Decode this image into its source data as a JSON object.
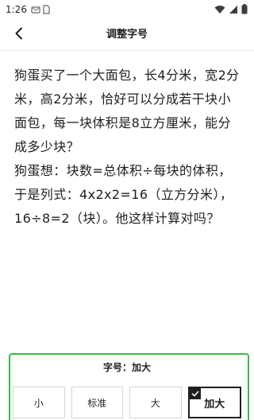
{
  "status_bar": {
    "time": "1:26",
    "icons": [
      "notification-icon",
      "sim-card-icon",
      "wifi-icon",
      "signal-icon",
      "battery-icon"
    ]
  },
  "app_bar": {
    "title": "调整字号",
    "back_icon": "chevron-left-icon"
  },
  "content": {
    "paragraph_1": "狗蛋买了一个大面包，长4分米，宽2分米，高2分米，恰好可以分成若干块小面包，每一块体积是8立方厘米，能分成多少块？",
    "paragraph_2": "狗蛋想：块数=总体积÷每块的体积，于是列式：4x2x2=16（立方分米），16÷8=2（块）。他这样计算对吗？"
  },
  "font_size": {
    "label": "字号：加大",
    "options": [
      {
        "label": "小",
        "selected": false
      },
      {
        "label": "标准",
        "selected": false
      },
      {
        "label": "大",
        "selected": false
      },
      {
        "label": "加大",
        "selected": true
      }
    ]
  },
  "colors": {
    "accent_border": "#3dba4e",
    "selected_border": "#1f1f1f"
  }
}
